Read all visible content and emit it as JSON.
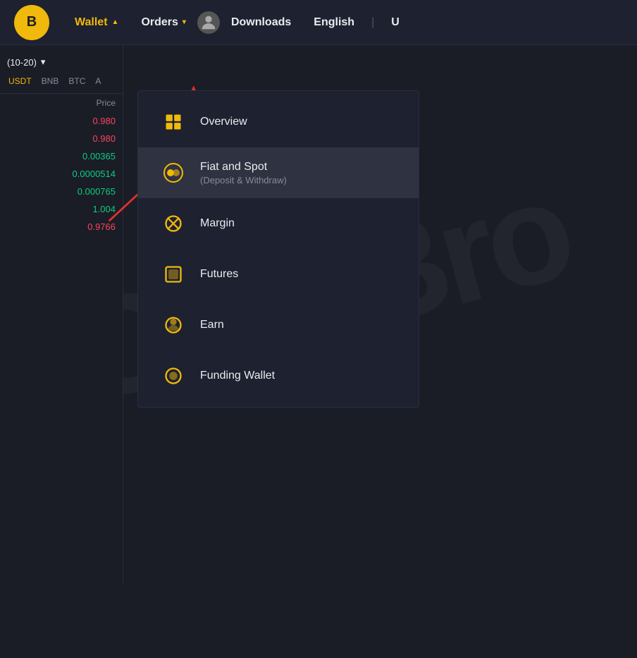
{
  "watermark": {
    "text": "CoinBro"
  },
  "navbar": {
    "wallet_label": "Wallet",
    "wallet_arrow": "▲",
    "orders_label": "Orders",
    "orders_arrow": "▾",
    "downloads_label": "Downloads",
    "english_label": "English",
    "u_label": "U"
  },
  "sidebar": {
    "filter_range": "(10-20)",
    "coin_tabs": [
      "USDT",
      "BNB",
      "BTC",
      "A"
    ],
    "price_header": "Price",
    "prices": [
      {
        "value": "0.980",
        "color": "red"
      },
      {
        "value": "0.980",
        "color": "red"
      },
      {
        "value": "0.00365",
        "color": "green"
      },
      {
        "value": "0.0000514",
        "color": "green"
      },
      {
        "value": "0.000765",
        "color": "green"
      },
      {
        "value": "1.004",
        "color": "green"
      },
      {
        "value": "0.9766",
        "color": "red"
      }
    ]
  },
  "wallet_menu": {
    "items": [
      {
        "id": "overview",
        "icon": "⊞",
        "label": "Overview",
        "sublabel": null,
        "highlighted": false
      },
      {
        "id": "fiat-and-spot",
        "icon": "⊙",
        "label": "Fiat and Spot",
        "sublabel": "(Deposit & Withdraw)",
        "highlighted": true
      },
      {
        "id": "margin",
        "icon": "✕",
        "label": "Margin",
        "sublabel": null,
        "highlighted": false
      },
      {
        "id": "futures",
        "icon": "▣",
        "label": "Futures",
        "sublabel": null,
        "highlighted": false
      },
      {
        "id": "earn",
        "icon": "⊗",
        "label": "Earn",
        "sublabel": null,
        "highlighted": false
      },
      {
        "id": "funding-wallet",
        "icon": "◎",
        "label": "Funding Wallet",
        "sublabel": null,
        "highlighted": false
      }
    ]
  },
  "colors": {
    "accent": "#f0b90b",
    "red": "#f6465d",
    "green": "#0ecb81",
    "bg_dark": "#1a1d26",
    "bg_nav": "#1e2130",
    "text_primary": "#eaecef",
    "text_secondary": "#848e9c"
  }
}
